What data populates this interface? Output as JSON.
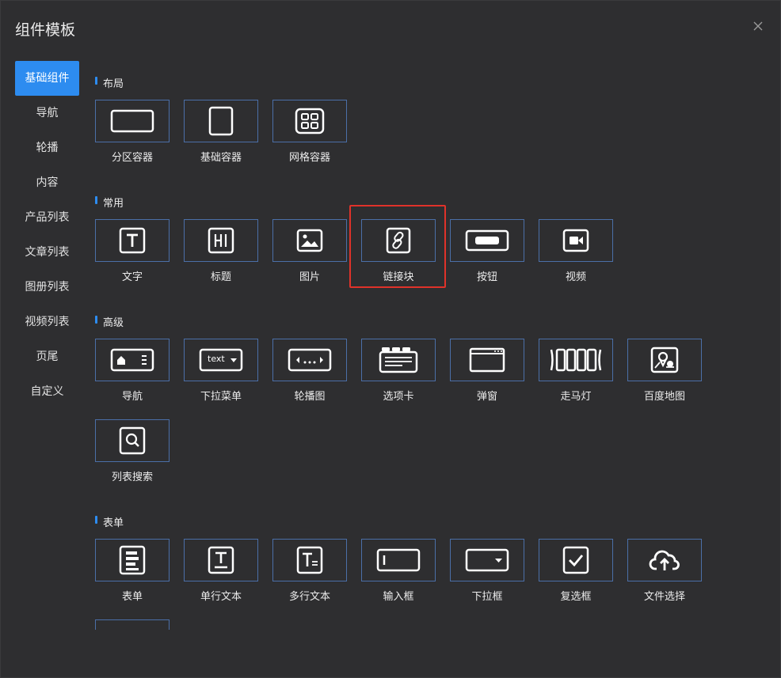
{
  "dialog": {
    "title": "组件模板"
  },
  "sidebar": {
    "items": [
      {
        "label": "基础组件",
        "active": true
      },
      {
        "label": "导航"
      },
      {
        "label": "轮播"
      },
      {
        "label": "内容"
      },
      {
        "label": "产品列表"
      },
      {
        "label": "文章列表"
      },
      {
        "label": "图册列表"
      },
      {
        "label": "视频列表"
      },
      {
        "label": "页尾"
      },
      {
        "label": "自定义"
      }
    ]
  },
  "sections": {
    "layout": {
      "title": "布局",
      "items": [
        {
          "label": "分区容器",
          "icon": "section-container-icon"
        },
        {
          "label": "基础容器",
          "icon": "basic-container-icon"
        },
        {
          "label": "网格容器",
          "icon": "grid-container-icon"
        }
      ]
    },
    "common": {
      "title": "常用",
      "items": [
        {
          "label": "文字",
          "icon": "text-icon"
        },
        {
          "label": "标题",
          "icon": "heading-icon"
        },
        {
          "label": "图片",
          "icon": "image-icon"
        },
        {
          "label": "链接块",
          "icon": "link-icon"
        },
        {
          "label": "按钮",
          "icon": "button-icon"
        },
        {
          "label": "视频",
          "icon": "video-icon"
        }
      ]
    },
    "advanced": {
      "title": "高级",
      "items": [
        {
          "label": "导航",
          "icon": "nav-icon"
        },
        {
          "label": "下拉菜单",
          "icon": "dropdown-menu-icon",
          "icon_text": "text"
        },
        {
          "label": "轮播图",
          "icon": "carousel-icon"
        },
        {
          "label": "选项卡",
          "icon": "tabs-icon"
        },
        {
          "label": "弹窗",
          "icon": "popup-icon"
        },
        {
          "label": "走马灯",
          "icon": "marquee-icon"
        },
        {
          "label": "百度地图",
          "icon": "map-icon"
        },
        {
          "label": "列表搜索",
          "icon": "list-search-icon"
        }
      ]
    },
    "form": {
      "title": "表单",
      "items": [
        {
          "label": "表单",
          "icon": "form-icon"
        },
        {
          "label": "单行文本",
          "icon": "single-line-text-icon"
        },
        {
          "label": "多行文本",
          "icon": "multi-line-text-icon"
        },
        {
          "label": "输入框",
          "icon": "input-box-icon"
        },
        {
          "label": "下拉框",
          "icon": "select-box-icon"
        },
        {
          "label": "复选框",
          "icon": "checkbox-icon"
        },
        {
          "label": "文件选择",
          "icon": "file-upload-icon"
        }
      ]
    }
  },
  "colors": {
    "accent": "#2d8cf0",
    "card_border": "#4b6fa8",
    "highlight": "#e0322a",
    "background": "#2e2e30"
  }
}
